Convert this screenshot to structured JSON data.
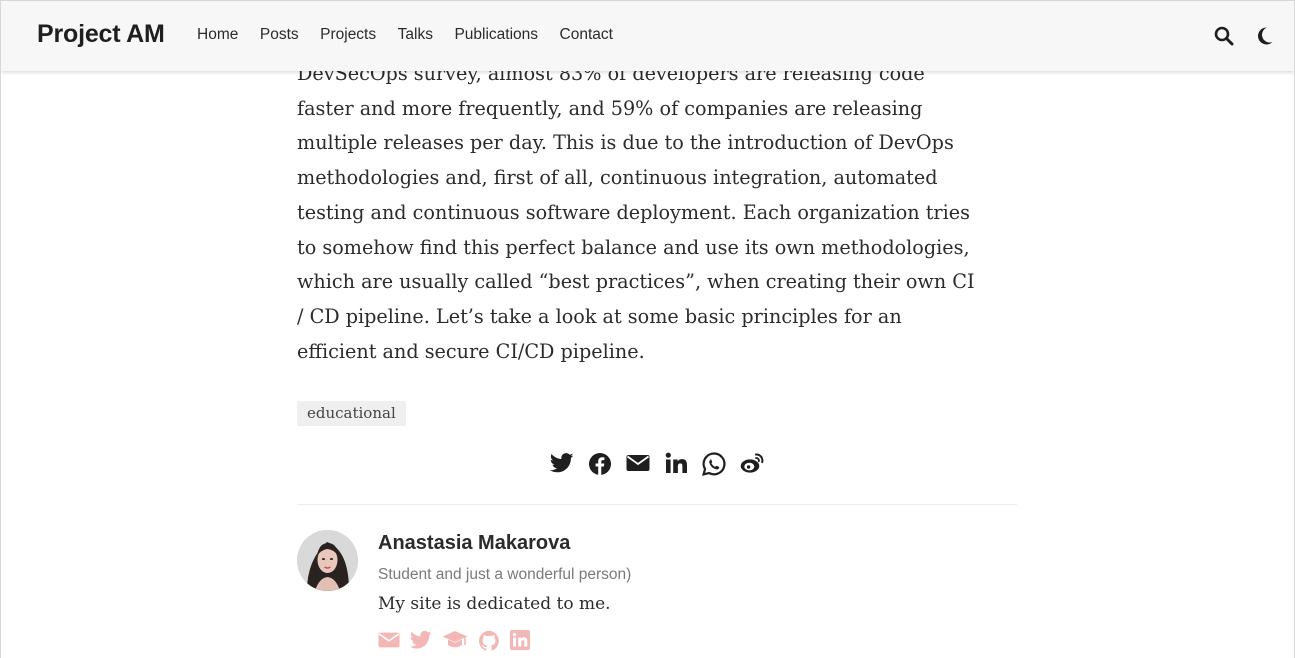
{
  "navbar": {
    "brand": "Project AM",
    "links": [
      "Home",
      "Posts",
      "Projects",
      "Talks",
      "Publications",
      "Contact"
    ],
    "tools": [
      "search-icon",
      "moon-icon"
    ]
  },
  "article": {
    "lines": [
      "DevSecOps survey, almost 83% of developers are releasing code",
      "faster and more frequently, and 59% of companies are releasing",
      "multiple releases per day. This is due to the introduction of DevOps",
      "methodologies and, first of all, continuous integration, automated",
      "testing and continuous software deployment. Each organization tries",
      "to somehow find this perfect balance and use its own methodologies,",
      "which are usually called “best practices”, when creating their own CI",
      "/ CD pipeline. Let’s take a look at some basic principles for an",
      "efficient and secure CI/CD pipeline."
    ],
    "tag": "educational"
  },
  "share": {
    "icons": [
      "twitter-icon",
      "facebook-icon",
      "email-icon",
      "linkedin-icon",
      "whatsapp-icon",
      "weibo-icon"
    ],
    "color": "#1f1f1f"
  },
  "author": {
    "name": "Anastasia Makarova",
    "role": "Student and just a wonderful person)",
    "bio": "My site is dedicated to me.",
    "links": [
      "email-icon",
      "twitter-icon",
      "graduation-cap-icon",
      "github-icon",
      "linkedin-icon"
    ],
    "link_color": "#f3b8b5"
  }
}
